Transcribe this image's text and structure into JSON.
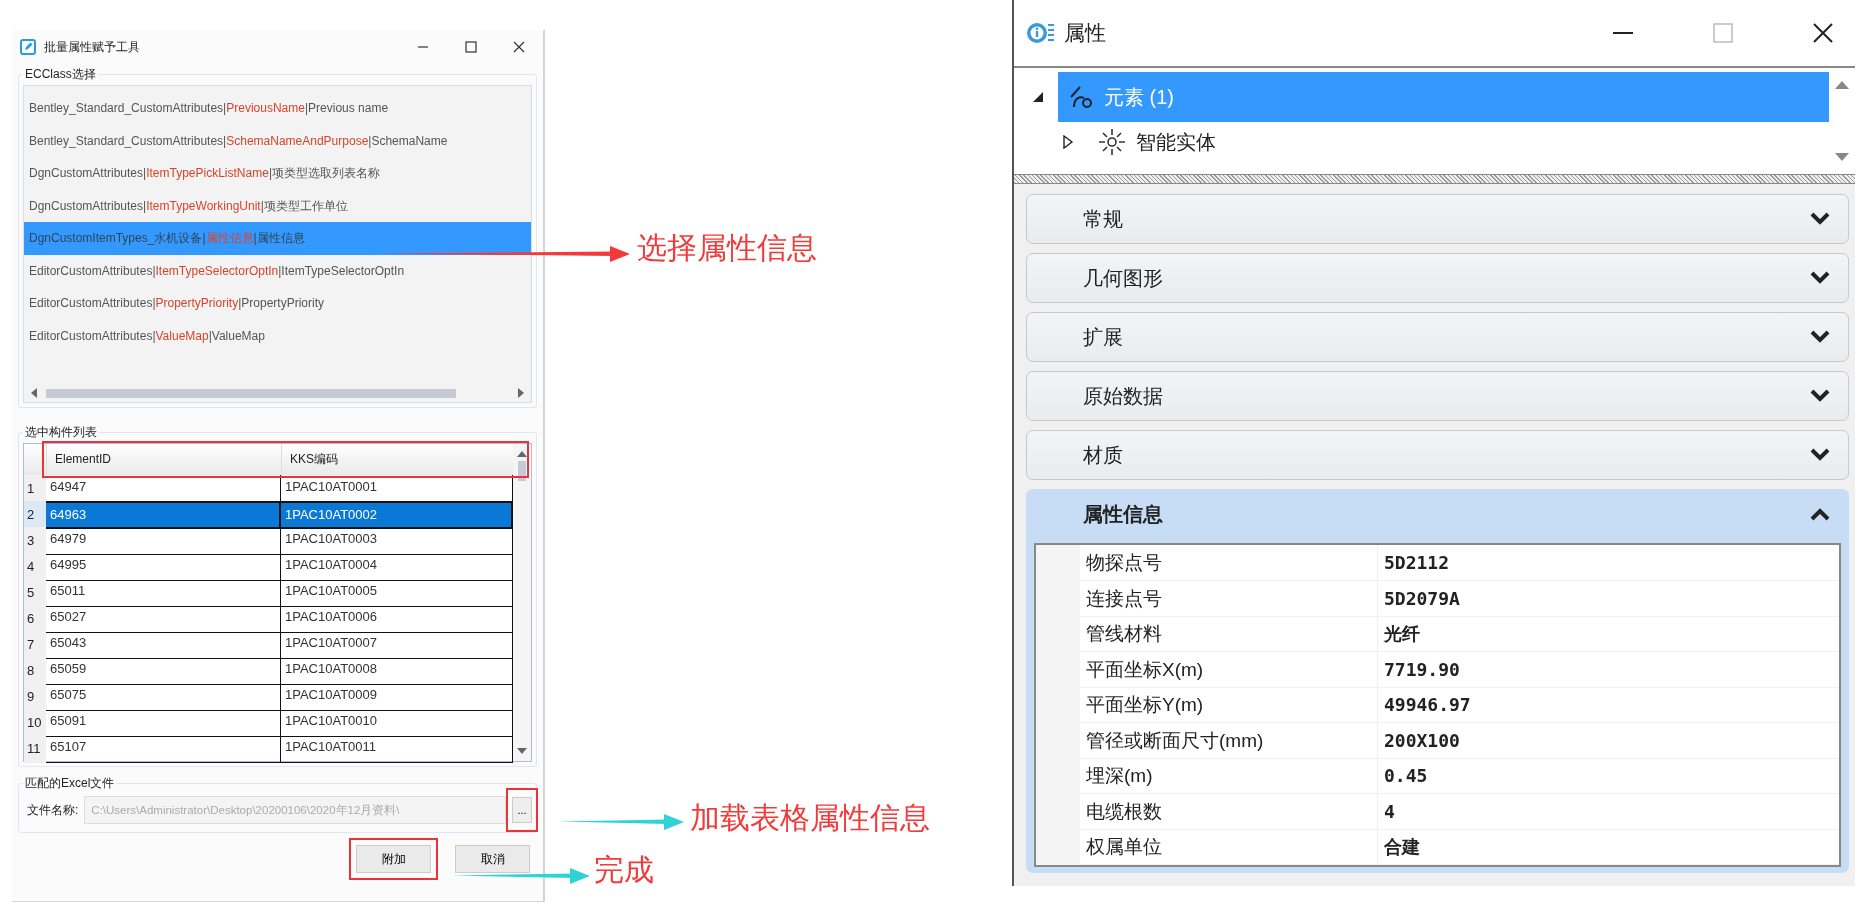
{
  "dialog": {
    "title": "批量属性赋予工具",
    "ecclass": {
      "label": "ECClass选择",
      "items": [
        {
          "prefix": "Bentley_Standard_CustomAttributes|",
          "name": "PreviousName",
          "suffix": "|Previous name",
          "selected": false
        },
        {
          "prefix": "Bentley_Standard_CustomAttributes|",
          "name": "SchemaNameAndPurpose",
          "suffix": "|SchemaName",
          "selected": false
        },
        {
          "prefix": "DgnCustomAttributes|",
          "name": "ItemTypePickListName",
          "suffix": "|项类型选取列表名称",
          "selected": false
        },
        {
          "prefix": "DgnCustomAttributes|",
          "name": "ItemTypeWorkingUnit",
          "suffix": "|项类型工作单位",
          "selected": false
        },
        {
          "prefix": "DgnCustomItemTypes_水机设备|",
          "name": "属性信息",
          "suffix": "|属性信息",
          "selected": true
        },
        {
          "prefix": "EditorCustomAttributes|",
          "name": "ItemTypeSelectorOptIn",
          "suffix": "|ItemTypeSelectorOptIn",
          "selected": false
        },
        {
          "prefix": "EditorCustomAttributes|",
          "name": "PropertyPriority",
          "suffix": "|PropertyPriority",
          "selected": false
        },
        {
          "prefix": "EditorCustomAttributes|",
          "name": "ValueMap",
          "suffix": "|ValueMap",
          "selected": false
        }
      ]
    },
    "element_list": {
      "label": "选中构件列表",
      "header_highlighted": true,
      "columns": [
        "ElementID",
        "KKS编码"
      ],
      "rows": [
        {
          "index": "1",
          "element_id": "64947",
          "kks": "1PAC10AT0001",
          "selected": false
        },
        {
          "index": "2",
          "element_id": "64963",
          "kks": "1PAC10AT0002",
          "selected": true
        },
        {
          "index": "3",
          "element_id": "64979",
          "kks": "1PAC10AT0003",
          "selected": false
        },
        {
          "index": "4",
          "element_id": "64995",
          "kks": "1PAC10AT0004",
          "selected": false
        },
        {
          "index": "5",
          "element_id": "65011",
          "kks": "1PAC10AT0005",
          "selected": false
        },
        {
          "index": "6",
          "element_id": "65027",
          "kks": "1PAC10AT0006",
          "selected": false
        },
        {
          "index": "7",
          "element_id": "65043",
          "kks": "1PAC10AT0007",
          "selected": false
        },
        {
          "index": "8",
          "element_id": "65059",
          "kks": "1PAC10AT0008",
          "selected": false
        },
        {
          "index": "9",
          "element_id": "65075",
          "kks": "1PAC10AT0009",
          "selected": false
        },
        {
          "index": "10",
          "element_id": "65091",
          "kks": "1PAC10AT0010",
          "selected": false
        },
        {
          "index": "11",
          "element_id": "65107",
          "kks": "1PAC10AT0011",
          "selected": false
        }
      ]
    },
    "excel": {
      "label": "匹配的Excel文件",
      "field_label": "文件名称:",
      "value": "C:\\Users\\Administrator\\Desktop\\20200106\\2020年12月资料\\",
      "browse": "...",
      "browse_highlighted": true,
      "disabled": true
    },
    "buttons": [
      {
        "label": "附加",
        "highlighted": true
      },
      {
        "label": "取消",
        "highlighted": false
      }
    ]
  },
  "annotations": [
    {
      "text": "选择属性信息",
      "color": "#f23a3a"
    },
    {
      "text": "加载表格属性信息",
      "color": "#2fd3d6"
    },
    {
      "text": "完成",
      "color": "#2fd3d6"
    }
  ],
  "properties_panel": {
    "title": "属性",
    "tree": [
      {
        "label": "元素 (1)",
        "expanded": true,
        "selected": true,
        "children": [
          {
            "label": "智能实体",
            "expanded": false,
            "selected": false
          }
        ]
      }
    ],
    "sections": [
      {
        "label": "常规",
        "expanded": false
      },
      {
        "label": "几何图形",
        "expanded": false
      },
      {
        "label": "扩展",
        "expanded": false
      },
      {
        "label": "原始数据",
        "expanded": false
      },
      {
        "label": "材质",
        "expanded": false
      },
      {
        "label": "属性信息",
        "expanded": true,
        "rows": [
          {
            "name": "物探点号",
            "value": "5D2112"
          },
          {
            "name": "连接点号",
            "value": "5D2079A"
          },
          {
            "name": "管线材料",
            "value": "光纤"
          },
          {
            "name": "平面坐标X(m)",
            "value": "7719.90"
          },
          {
            "name": "平面坐标Y(m)",
            "value": "49946.97"
          },
          {
            "name": "管径或断面尺寸(mm)",
            "value": "200X100"
          },
          {
            "name": "埋深(m)",
            "value": "0.45"
          },
          {
            "name": "电缆根数",
            "value": "4"
          },
          {
            "name": "权属单位",
            "value": "合建"
          }
        ]
      }
    ]
  }
}
